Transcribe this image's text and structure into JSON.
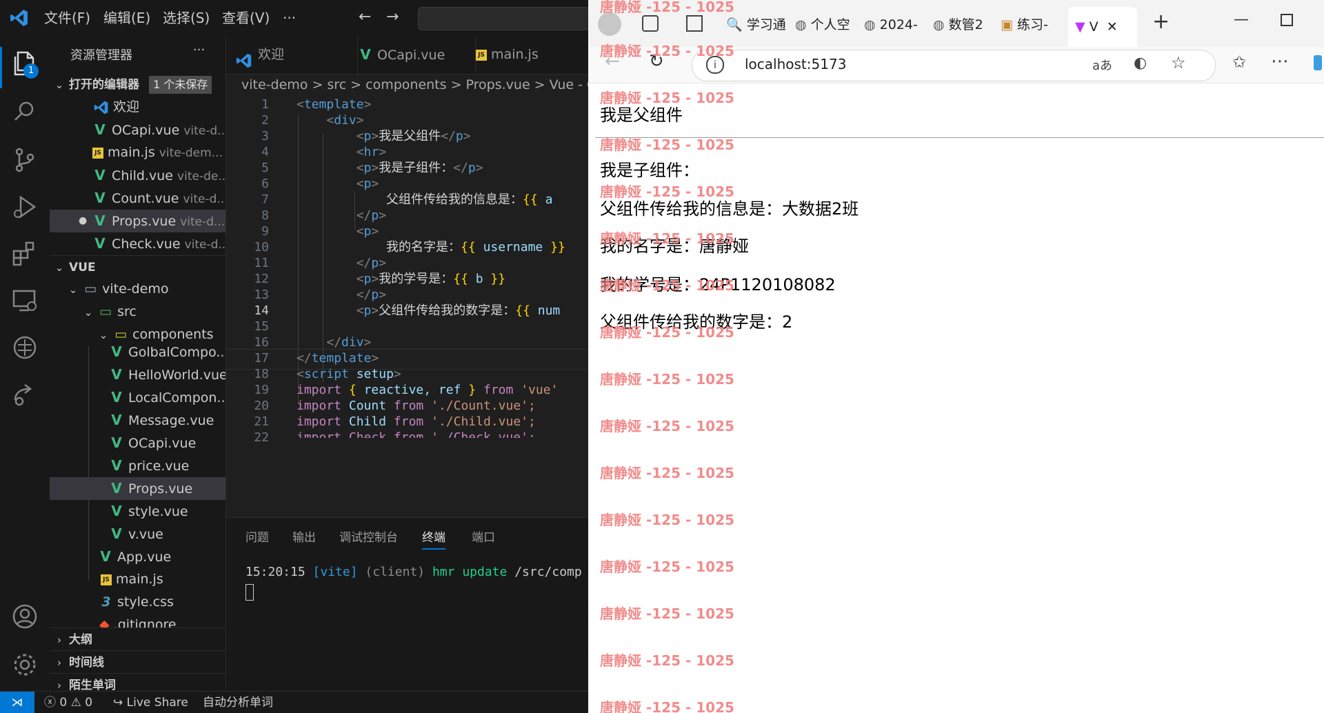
{
  "vscode": {
    "menu": [
      "文件(F)",
      "编辑(E)",
      "选择(S)",
      "查看(V)",
      "···"
    ],
    "explorer_title": "资源管理器",
    "explorer_more": "···",
    "badge_count": "1",
    "open_editors_label": "打开的编辑器",
    "unsaved_label": "1 个未保存",
    "open_editors": [
      {
        "name": "欢迎",
        "desc": "",
        "icon": "vscode"
      },
      {
        "name": "OCapi.vue",
        "desc": "vite-d...",
        "icon": "vue"
      },
      {
        "name": "main.js",
        "desc": "vite-dem...",
        "icon": "js"
      },
      {
        "name": "Child.vue",
        "desc": "vite-de...",
        "icon": "vue"
      },
      {
        "name": "Count.vue",
        "desc": "vite-d...",
        "icon": "vue"
      },
      {
        "name": "Props.vue",
        "desc": "vite-d...",
        "icon": "vue"
      },
      {
        "name": "Check.vue",
        "desc": "vite-d...",
        "icon": "vue"
      }
    ],
    "workspace_label": "VUE",
    "tree": [
      {
        "name": "vite-demo",
        "type": "folder"
      },
      {
        "name": "src",
        "type": "folder"
      },
      {
        "name": "components",
        "type": "folder"
      },
      {
        "name": "GolbalCompo...",
        "type": "vue"
      },
      {
        "name": "HelloWorld.vue",
        "type": "vue"
      },
      {
        "name": "LocalCompon...",
        "type": "vue"
      },
      {
        "name": "Message.vue",
        "type": "vue"
      },
      {
        "name": "OCapi.vue",
        "type": "vue"
      },
      {
        "name": "price.vue",
        "type": "vue"
      },
      {
        "name": "Props.vue",
        "type": "vue"
      },
      {
        "name": "style.vue",
        "type": "vue"
      },
      {
        "name": "v.vue",
        "type": "vue"
      },
      {
        "name": "App.vue",
        "type": "vue"
      },
      {
        "name": "main.js",
        "type": "js"
      },
      {
        "name": "style.css",
        "type": "css"
      },
      {
        "name": ".gitignore",
        "type": "git"
      }
    ],
    "bottom_sections": [
      "大纲",
      "时间线",
      "陌生单词"
    ],
    "tabs": [
      "欢迎",
      "OCapi.vue",
      "main.js"
    ],
    "breadcrumb": "vite-demo > src > components > Props.vue > Vue - O",
    "code_lines": [
      "1",
      "2",
      "3",
      "4",
      "5",
      "6",
      "7",
      "8",
      "9",
      "10",
      "11",
      "12",
      "13",
      "14",
      "15",
      "16",
      "17",
      "18",
      "19",
      "20",
      "21",
      "22"
    ],
    "current_line": "14",
    "code": {
      "l1_tag": "template",
      "l2_tag": "div",
      "l3_text": "我是父组件",
      "l4_tag": "hr",
      "l5_text": "我是子组件：",
      "l7_text": "父组件传给我的信息是：",
      "l7_var": "a",
      "l10_text": "我的名字是：",
      "l10_var": "username",
      "l12_text": "我的学号是：",
      "l12_var": "b",
      "l14_text": "父组件传给我的数字是：",
      "l14_var": "num",
      "l18_attr": "setup",
      "l19_vars": "reactive, ref",
      "l19_str": "'vue'",
      "l20_name": "Count",
      "l20_str": "'./Count.vue';",
      "l21_name": "Child",
      "l21_str": "'./Child.vue';",
      "l22_partial": "import Check from './Check.vue';"
    },
    "panel_tabs": [
      "问题",
      "输出",
      "调试控制台",
      "终端",
      "端口"
    ],
    "active_panel_tab": "终端",
    "terminal": {
      "time": "15:20:15",
      "tag": "[vite]",
      "client": "(client)",
      "msg": "hmr update",
      "path": "/src/comp"
    },
    "status": {
      "errors": "0",
      "warnings": "0",
      "live_share": "Live Share",
      "extra": "自动分析单词"
    }
  },
  "browser": {
    "tabs": [
      "学习通",
      "个人空",
      "2024-",
      "数管2",
      "练习-",
      "V"
    ],
    "url": "localhost:5173",
    "content": {
      "parent": "我是父组件",
      "child": "我是子组件：",
      "info": "父组件传给我的信息是：大数据2班",
      "name": "我的名字是：唐静娅",
      "id": "我的学号是：24P1120108082",
      "num": "父组件传给我的数字是：2"
    },
    "watermark": "唐静娅 -125 - 1025"
  }
}
